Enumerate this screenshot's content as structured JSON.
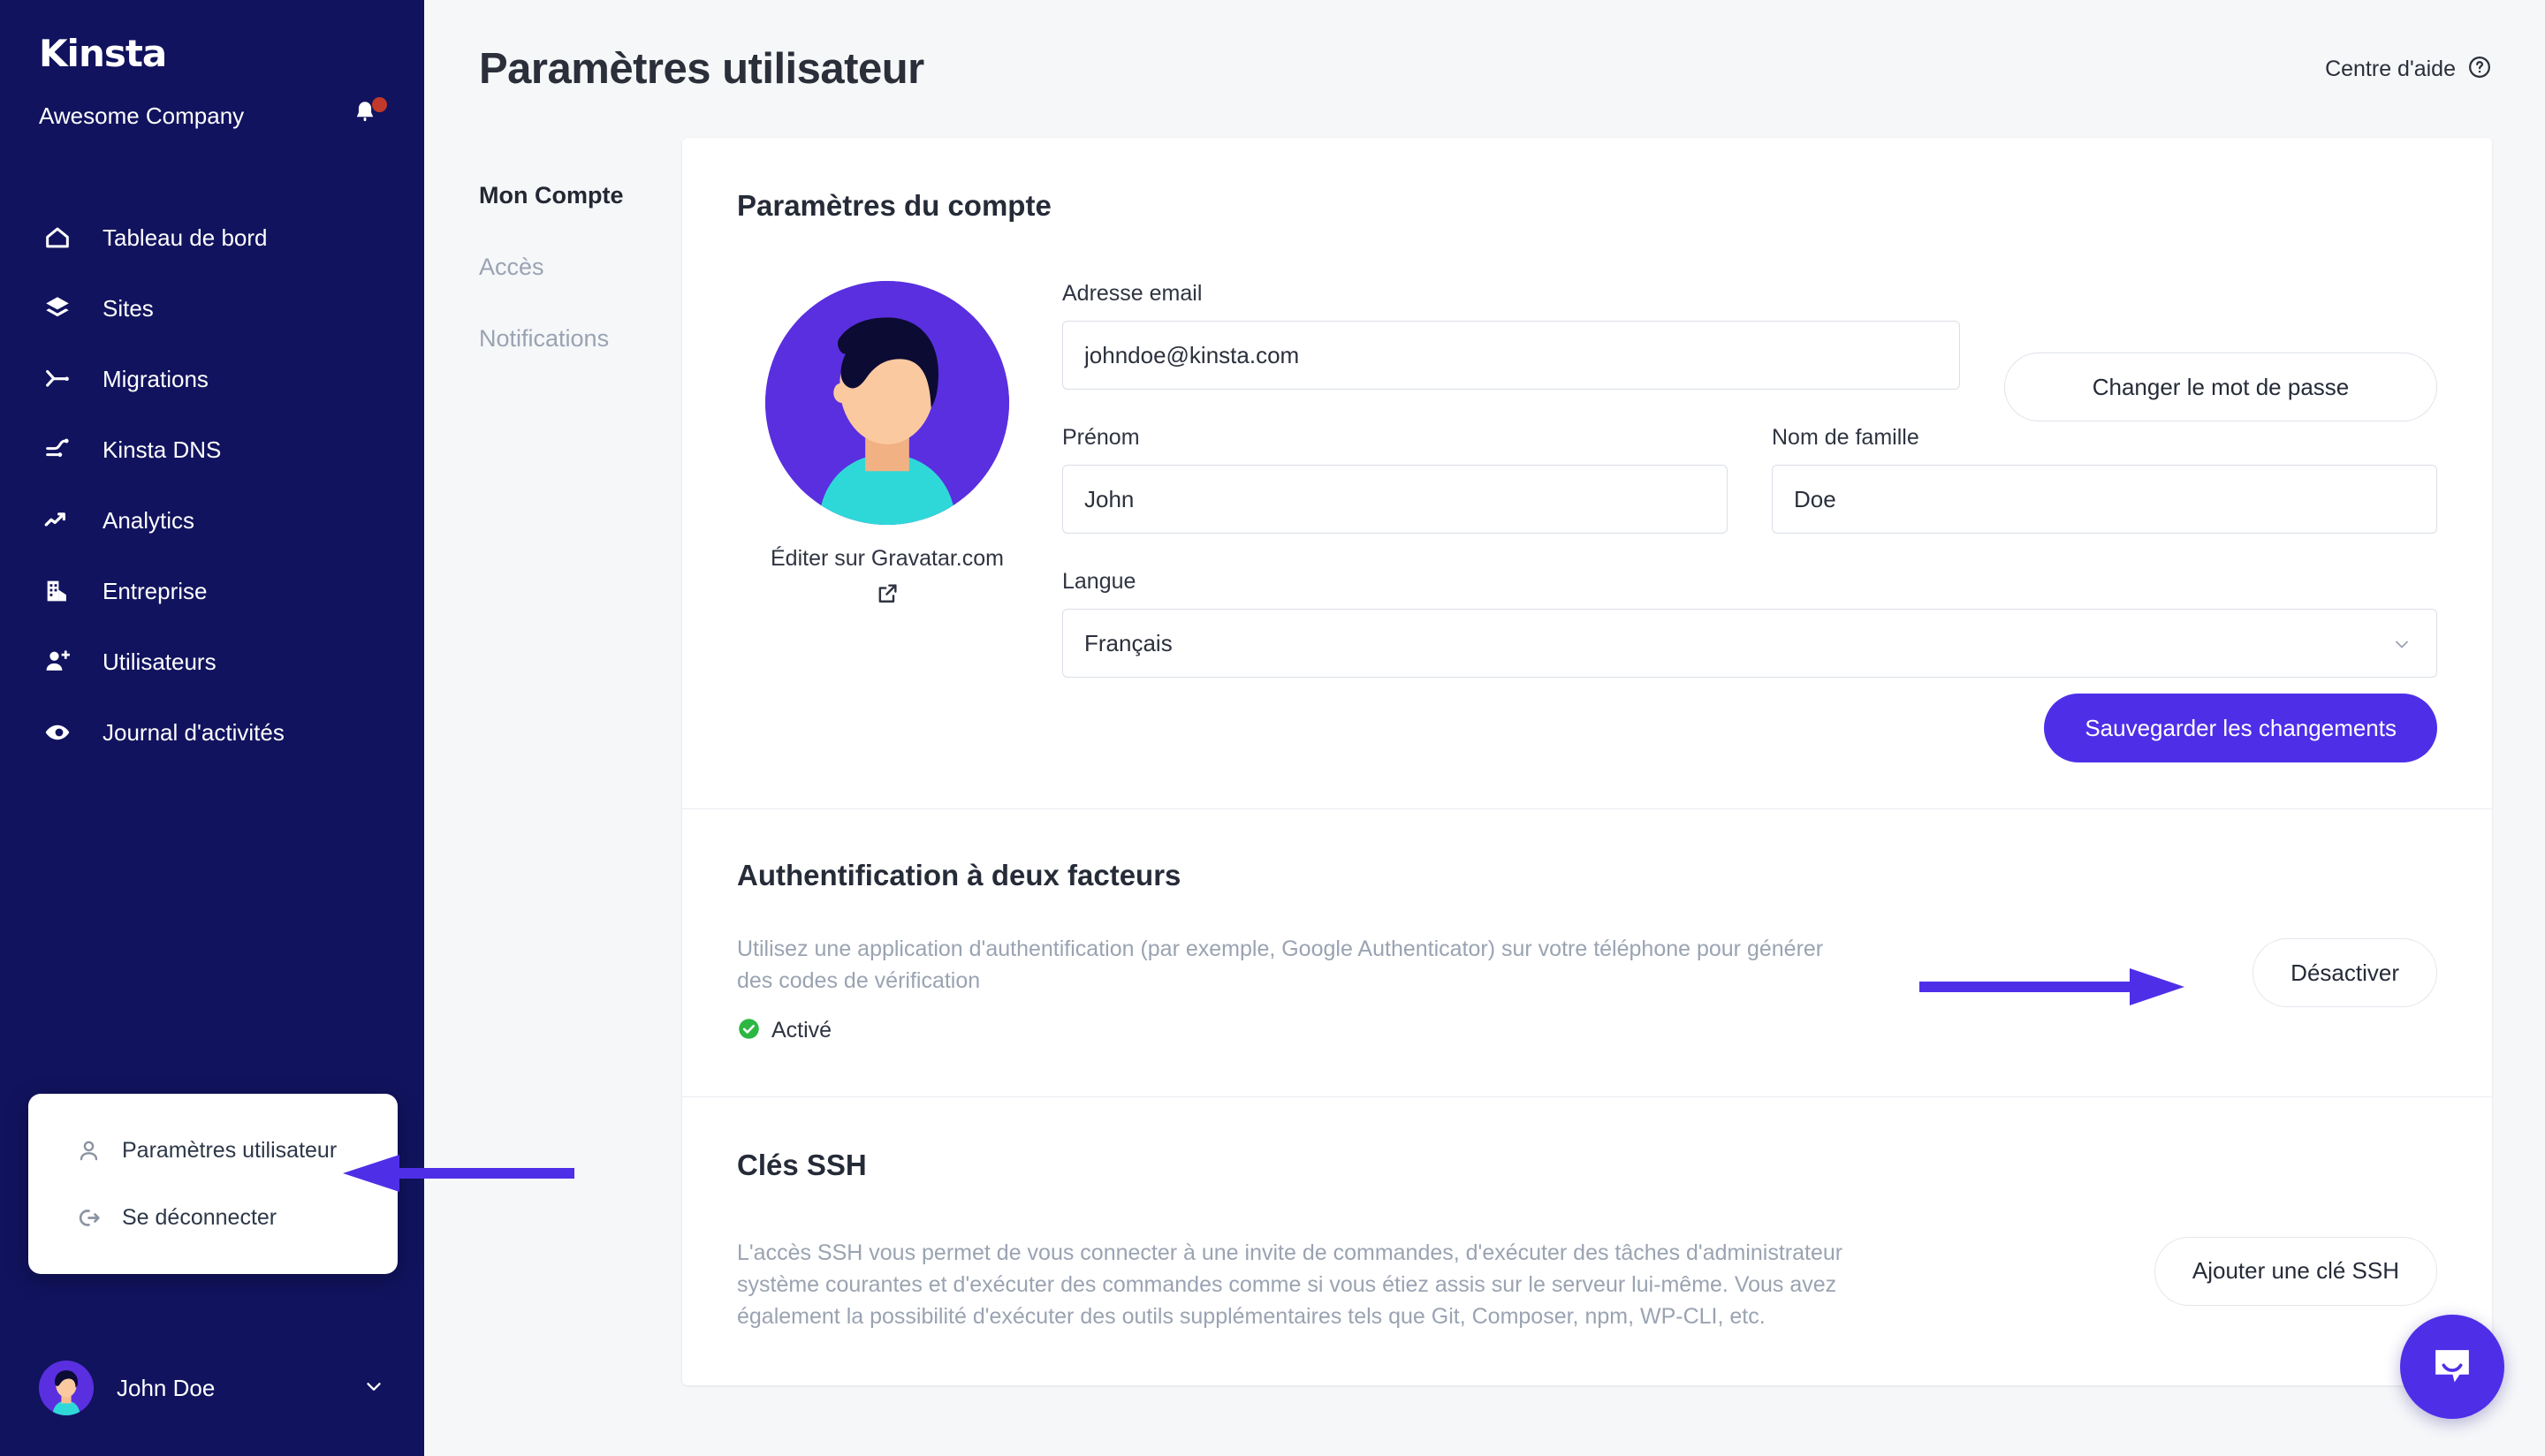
{
  "sidebar": {
    "logo": "Kinsta",
    "org_name": "Awesome Company",
    "notifications_icon": "bell-icon",
    "nav_items": [
      {
        "label": "Tableau de bord",
        "icon": "home-icon"
      },
      {
        "label": "Sites",
        "icon": "layers-icon"
      },
      {
        "label": "Migrations",
        "icon": "migration-icon"
      },
      {
        "label": "Kinsta DNS",
        "icon": "dns-icon"
      },
      {
        "label": "Analytics",
        "icon": "trending-up-icon"
      },
      {
        "label": "Entreprise",
        "icon": "building-icon"
      },
      {
        "label": "Utilisateurs",
        "icon": "user-plus-icon"
      },
      {
        "label": "Journal d'activités",
        "icon": "eye-icon"
      }
    ],
    "user_menu": [
      {
        "label": "Paramètres utilisateur",
        "icon": "user-icon"
      },
      {
        "label": "Se déconnecter",
        "icon": "logout-icon"
      }
    ],
    "user_name": "John Doe",
    "user_chevron_icon": "chevron-down-icon"
  },
  "header": {
    "title": "Paramètres utilisateur",
    "help_label": "Centre d'aide",
    "help_icon": "question-circle-icon"
  },
  "subnav": [
    {
      "label": "Mon Compte",
      "active": true
    },
    {
      "label": "Accès",
      "active": false
    },
    {
      "label": "Notifications",
      "active": false
    }
  ],
  "account": {
    "title": "Paramètres du compte",
    "gravatar_label": "Éditer sur Gravatar.com",
    "gravatar_icon": "external-link-icon",
    "email_label": "Adresse email",
    "email_value": "johndoe@kinsta.com",
    "change_password_label": "Changer le mot de passe",
    "firstname_label": "Prénom",
    "firstname_value": "John",
    "lastname_label": "Nom de famille",
    "lastname_value": "Doe",
    "language_label": "Langue",
    "language_value": "Français",
    "language_chevron_icon": "chevron-down-icon",
    "save_label": "Sauvegarder les changements"
  },
  "twofa": {
    "title": "Authentification à deux facteurs",
    "description": "Utilisez une application d'authentification (par exemple, Google Authenticator) sur votre téléphone pour générer des codes de vérification",
    "status_label": "Activé",
    "status_icon": "check-circle-icon",
    "status_color": "#2cb742",
    "button_label": "Désactiver"
  },
  "ssh": {
    "title": "Clés SSH",
    "description": "L'accès SSH vous permet de vous connecter à une invite de commandes, d'exécuter des tâches d'administrateur système courantes et d'exécuter des commandes comme si vous étiez assis sur le serveur lui-même. Vous avez également la possibilité d'exécuter des outils supplémentaires tels que Git, Composer, npm, WP-CLI, etc.",
    "button_label": "Ajouter une clé SSH"
  },
  "widgets": {
    "intercom_icon": "chat-bubble-icon"
  },
  "colors": {
    "sidebar_bg": "#11135e",
    "accent": "#4f2ee8",
    "page_bg": "#f6f7f9",
    "annotation_arrow": "#4f2ee8",
    "notification_dot": "#c0392b"
  }
}
